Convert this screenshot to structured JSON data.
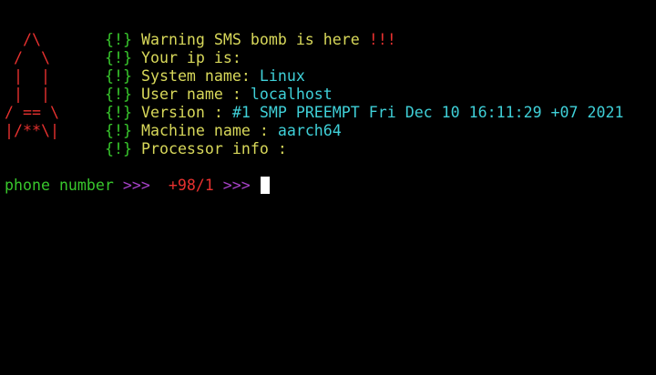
{
  "banner": {
    "art_lines": [
      "  /\\  ",
      " /  \\ ",
      " |  | ",
      " |  | ",
      "/ == \\",
      "|/**\\|"
    ],
    "info_lines": [
      {
        "tag": "{!}",
        "label": "Warning SMS bomb is here ",
        "value": "",
        "suffix": "!!!"
      },
      {
        "tag": "{!}",
        "label": "Your ip is:",
        "value": "",
        "suffix": ""
      },
      {
        "tag": "{!}",
        "label": "System name: ",
        "value": "Linux",
        "suffix": ""
      },
      {
        "tag": "{!}",
        "label": "User name : ",
        "value": "localhost",
        "suffix": ""
      },
      {
        "tag": "{!}",
        "label": "Version : ",
        "value": "#1 SMP PREEMPT Fri Dec 10 16:11:29 +07 2021",
        "suffix": ""
      },
      {
        "tag": "{!}",
        "label": "Machine name : ",
        "value": "aarch64",
        "suffix": ""
      },
      {
        "tag": "{!}",
        "label": "Processor info :",
        "value": "",
        "suffix": ""
      }
    ]
  },
  "prompt": {
    "label": "phone number",
    "arrow1": " >>> ",
    "input_value": " +98/1",
    "arrow2": " >>> "
  },
  "colors": {
    "background": "#000000",
    "red": "#e8312f",
    "green": "#38c72c",
    "yellow": "#d8d85a",
    "cyan": "#3fd0d8",
    "magenta": "#a742c9",
    "cursor": "#ffffff"
  }
}
